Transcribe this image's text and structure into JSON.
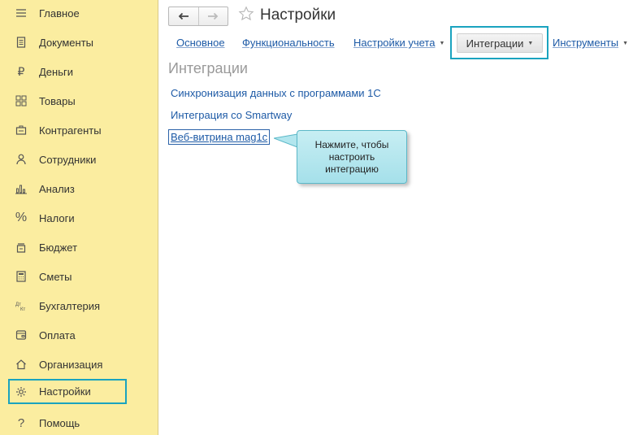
{
  "sidebar": {
    "items": [
      {
        "label": "Главное",
        "icon": "menu-lines-icon"
      },
      {
        "label": "Документы",
        "icon": "document-icon"
      },
      {
        "label": "Деньги",
        "icon": "ruble-icon"
      },
      {
        "label": "Товары",
        "icon": "grid-icon"
      },
      {
        "label": "Контрагенты",
        "icon": "contractors-icon"
      },
      {
        "label": "Сотрудники",
        "icon": "person-icon"
      },
      {
        "label": "Анализ",
        "icon": "bar-chart-icon"
      },
      {
        "label": "Налоги",
        "icon": "percent-icon"
      },
      {
        "label": "Бюджет",
        "icon": "wallet-icon"
      },
      {
        "label": "Сметы",
        "icon": "calculator-icon"
      },
      {
        "label": "Бухгалтерия",
        "icon": "debit-credit-icon"
      },
      {
        "label": "Оплата",
        "icon": "payment-icon"
      },
      {
        "label": "Организация",
        "icon": "home-icon"
      },
      {
        "label": "Настройки",
        "icon": "gear-icon"
      },
      {
        "label": "Помощь",
        "icon": "question-icon"
      }
    ],
    "active_index": 13
  },
  "header": {
    "title": "Настройки",
    "back_icon": "arrow-left-icon",
    "forward_icon": "arrow-right-icon",
    "favorite_icon": "star-icon"
  },
  "tabs": {
    "basic": "Основное",
    "functionality": "Функциональность",
    "accounting": "Настройки учета",
    "integrations": "Интеграции",
    "tools": "Инструменты"
  },
  "main": {
    "section_title": "Интеграции",
    "links": [
      "Синхронизация данных с программами 1С",
      "Интеграция со Smartway",
      "Веб-витрина mag1c"
    ]
  },
  "tooltip": {
    "text": "Нажмите, чтобы настроить интеграцию"
  },
  "colors": {
    "sidebar_bg": "#fbeda0",
    "highlight": "#1aa3bf",
    "link": "#1d5aa6",
    "tooltip_bg": "#b8e8ef"
  }
}
